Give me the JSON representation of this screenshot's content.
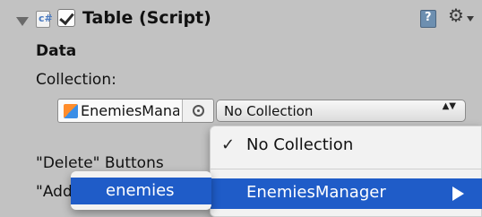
{
  "component": {
    "title": "Table (Script)",
    "script_badge": "c#",
    "enabled": true
  },
  "section": {
    "data_label": "Data"
  },
  "collection": {
    "label": "Collection:",
    "object_value": "EnemiesManager",
    "popup_value": "No Collection",
    "popup_arrows": "▲▼"
  },
  "labels": {
    "delete_buttons": "\"Delete\" Buttons",
    "add": "\"Add"
  },
  "dropdown": {
    "check": "✓",
    "no_collection": "No Collection",
    "enemies_manager": "EnemiesManager"
  },
  "submenu": {
    "enemies": "enemies"
  },
  "icons": {
    "gear": "⚙"
  },
  "colors": {
    "highlight": "#1f5cc8",
    "panel": "#c2c2c2"
  }
}
